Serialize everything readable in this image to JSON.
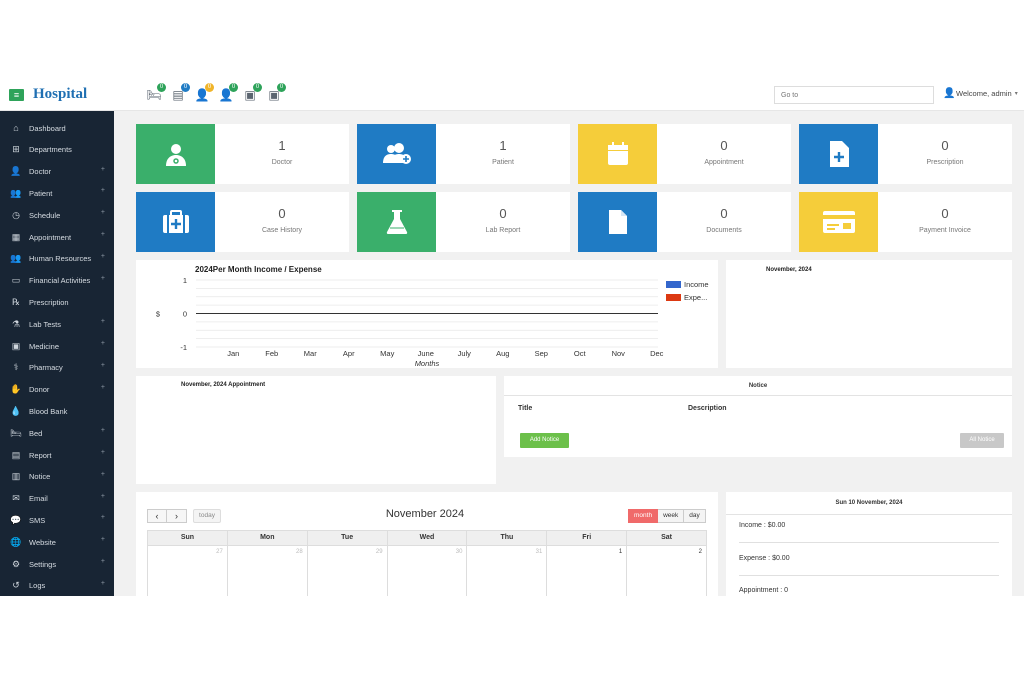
{
  "header": {
    "brand": "Hospital",
    "menu_icon": "≡",
    "quick_icons": [
      {
        "name": "bed-icon",
        "glyph": "🛏",
        "badge": "0",
        "badge_color": "#2ea35a"
      },
      {
        "name": "invoice-icon",
        "glyph": "▤",
        "badge": "0",
        "badge_color": "#1f7bc4"
      },
      {
        "name": "patient-icon",
        "glyph": "👤",
        "badge": "0",
        "badge_color": "#f0b429"
      },
      {
        "name": "doctor-icon",
        "glyph": "👤",
        "badge": "0",
        "badge_color": "#2ea35a"
      },
      {
        "name": "medicine-icon",
        "glyph": "▣",
        "badge": "0",
        "badge_color": "#2ea35a"
      },
      {
        "name": "lab-icon",
        "glyph": "▣",
        "badge": "0",
        "badge_color": "#2ea35a"
      }
    ],
    "search_placeholder": "Go to",
    "welcome": "Welcome, admin"
  },
  "sidebar": {
    "items": [
      {
        "label": "Dashboard",
        "icon": "⌂",
        "expandable": false
      },
      {
        "label": "Departments",
        "icon": "⊞",
        "expandable": false
      },
      {
        "label": "Doctor",
        "icon": "👤",
        "expandable": true
      },
      {
        "label": "Patient",
        "icon": "👥",
        "expandable": true
      },
      {
        "label": "Schedule",
        "icon": "◷",
        "expandable": true
      },
      {
        "label": "Appointment",
        "icon": "▦",
        "expandable": true
      },
      {
        "label": "Human Resources",
        "icon": "👥",
        "expandable": true
      },
      {
        "label": "Financial Activities",
        "icon": "▭",
        "expandable": true
      },
      {
        "label": "Prescription",
        "icon": "℞",
        "expandable": false
      },
      {
        "label": "Lab Tests",
        "icon": "⚗",
        "expandable": true
      },
      {
        "label": "Medicine",
        "icon": "▣",
        "expandable": true
      },
      {
        "label": "Pharmacy",
        "icon": "⚕",
        "expandable": true
      },
      {
        "label": "Donor",
        "icon": "✋",
        "expandable": true
      },
      {
        "label": "Blood Bank",
        "icon": "💧",
        "expandable": false
      },
      {
        "label": "Bed",
        "icon": "🛏",
        "expandable": true
      },
      {
        "label": "Report",
        "icon": "▤",
        "expandable": true
      },
      {
        "label": "Notice",
        "icon": "▥",
        "expandable": true
      },
      {
        "label": "Email",
        "icon": "✉",
        "expandable": true
      },
      {
        "label": "SMS",
        "icon": "💬",
        "expandable": true
      },
      {
        "label": "Website",
        "icon": "🌐",
        "expandable": true
      },
      {
        "label": "Settings",
        "icon": "⚙",
        "expandable": true
      },
      {
        "label": "Logs",
        "icon": "↺",
        "expandable": true
      }
    ]
  },
  "stats": [
    {
      "value": "1",
      "label": "Doctor",
      "icon": "doctor-icon",
      "color": "#3aaf6b"
    },
    {
      "value": "1",
      "label": "Patient",
      "icon": "patient-add-icon",
      "color": "#1f7bc4"
    },
    {
      "value": "0",
      "label": "Appointment",
      "icon": "calendar-icon",
      "color": "#f5cd3a"
    },
    {
      "value": "0",
      "label": "Prescription",
      "icon": "prescription-icon",
      "color": "#1f7bc4"
    },
    {
      "value": "0",
      "label": "Case History",
      "icon": "medkit-icon",
      "color": "#1f7bc4"
    },
    {
      "value": "0",
      "label": "Lab Report",
      "icon": "flask-icon",
      "color": "#3aaf6b"
    },
    {
      "value": "0",
      "label": "Documents",
      "icon": "document-icon",
      "color": "#1f7bc4"
    },
    {
      "value": "0",
      "label": "Payment Invoice",
      "icon": "invoice-icon",
      "color": "#f5cd3a"
    }
  ],
  "chart_data": {
    "type": "line",
    "title": "2024Per Month Income / Expense",
    "xlabel": "Months",
    "ylabel": "$",
    "categories": [
      "Jan",
      "Feb",
      "Mar",
      "Apr",
      "May",
      "June",
      "July",
      "Aug",
      "Sep",
      "Oct",
      "Nov",
      "Dec"
    ],
    "yticks": [
      "1",
      "0",
      "-1"
    ],
    "ylim": [
      -1,
      1
    ],
    "grid": true,
    "legend_position": "right",
    "series": [
      {
        "name": "Income",
        "color": "#3366cc",
        "values": [
          0,
          0,
          0,
          0,
          0,
          0,
          0,
          0,
          0,
          0,
          0,
          0
        ]
      },
      {
        "name": "Expe...",
        "color": "#dc3912",
        "values": [
          0,
          0,
          0,
          0,
          0,
          0,
          0,
          0,
          0,
          0,
          0,
          0
        ]
      }
    ]
  },
  "month_panel": {
    "title": "November, 2024"
  },
  "appointment_panel": {
    "title": "November, 2024 Appointment"
  },
  "notice": {
    "title": "Notice",
    "col_title": "Title",
    "col_description": "Description",
    "add_button": "Add Notice",
    "all_button": "All Notice"
  },
  "calendar": {
    "title": "November 2024",
    "prev": "‹",
    "next": "›",
    "today": "today",
    "views": [
      "month",
      "week",
      "day"
    ],
    "active_view": "month",
    "weekdays": [
      "Sun",
      "Mon",
      "Tue",
      "Wed",
      "Thu",
      "Fri",
      "Sat"
    ],
    "first_week": [
      {
        "day": "27",
        "current": false
      },
      {
        "day": "28",
        "current": false
      },
      {
        "day": "29",
        "current": false
      },
      {
        "day": "30",
        "current": false
      },
      {
        "day": "31",
        "current": false
      },
      {
        "day": "1",
        "current": true
      },
      {
        "day": "2",
        "current": true
      }
    ]
  },
  "summary": {
    "title": "Sun 10 November, 2024",
    "income": "Income : $0.00",
    "expense": "Expense : $0.00",
    "appointment": "Appointment : 0"
  }
}
